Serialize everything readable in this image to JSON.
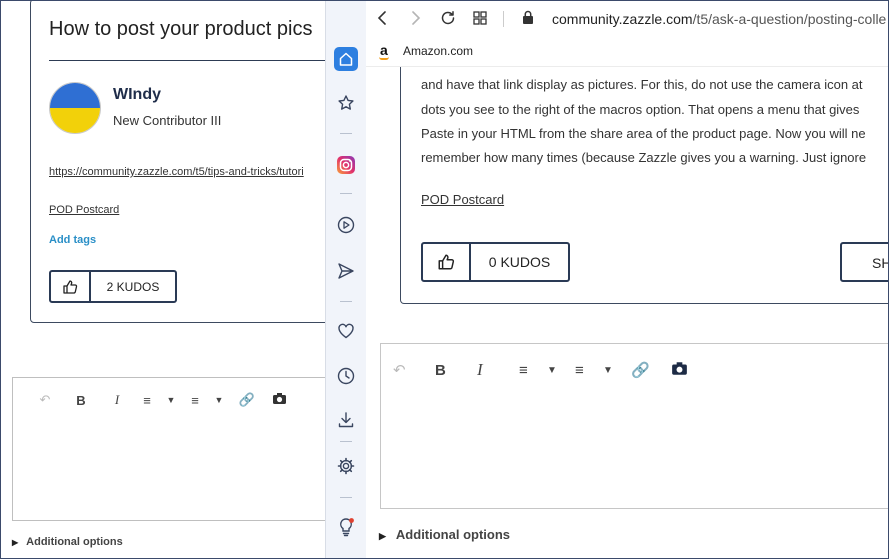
{
  "left_window": {
    "post_title": "How to post your product pics",
    "author": {
      "name": "WIndy",
      "rank": "New Contributor III"
    },
    "link": "https://community.zazzle.com/t5/tips-and-tricks/tutori",
    "label": "POD Postcard",
    "add_tags": "Add tags",
    "kudos": {
      "count": "2 KUDOS"
    },
    "editor": {
      "toolbar": {
        "bold": "B",
        "italic": "I"
      }
    },
    "additional_options": "Additional options"
  },
  "sidebar": {
    "items": [
      "home-icon",
      "star-icon",
      "instagram-icon",
      "play-icon",
      "send-icon",
      "heart-icon",
      "clock-icon",
      "download-icon",
      "gear-icon",
      "lightbulb-icon"
    ],
    "accent": "#2d7fe0"
  },
  "browser": {
    "url_domain": "community.zazzle.com",
    "url_path": "/t5/ask-a-question/posting-colle",
    "bookmark": "Amazon.com",
    "post_lines": [
      "and have that link display as pictures. For this, do not use the camera icon at",
      "dots you see to the right of the macros option. That opens a menu that gives",
      "Paste in your HTML from the share area of the product page. Now you will ne",
      "remember how many times (because Zazzle gives you a warning. Just ignore"
    ],
    "label": "POD Postcard",
    "kudos": {
      "count": "0 KUDOS"
    },
    "share_label": "SH",
    "editor": {
      "toolbar": {
        "bold": "B",
        "italic": "I"
      }
    },
    "additional_options": "Additional options"
  }
}
